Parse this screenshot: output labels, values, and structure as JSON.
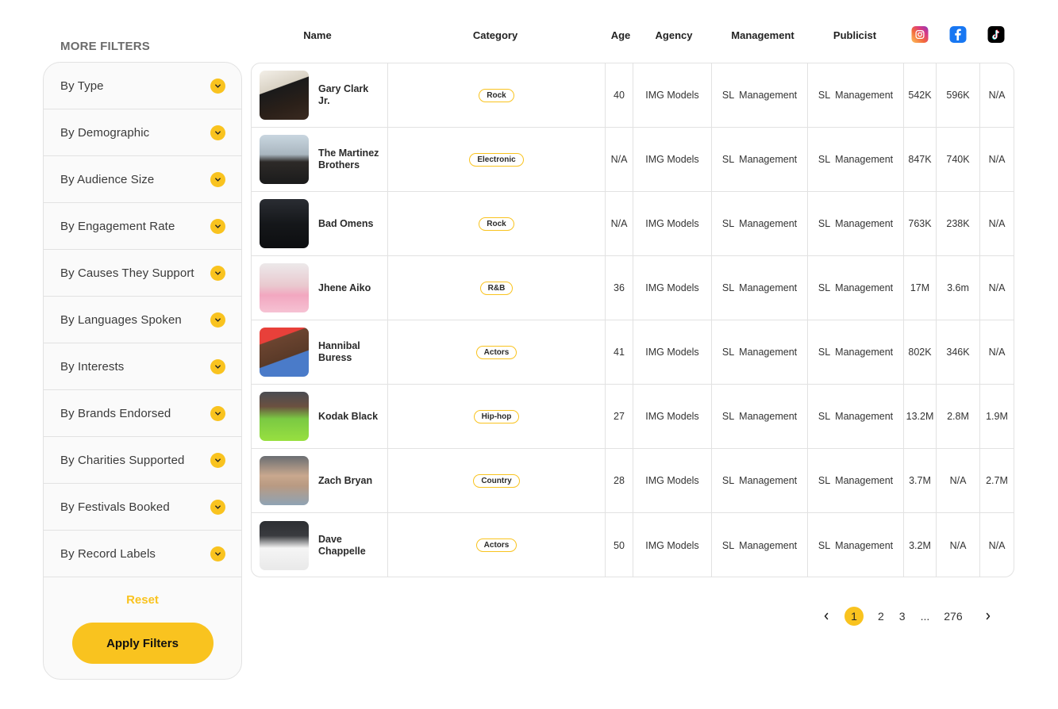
{
  "sidebar": {
    "title": "MORE FILTERS",
    "filters": [
      {
        "label": "By Type",
        "icon": "chevron-down-icon"
      },
      {
        "label": "By Demographic",
        "icon": "chevron-down-icon"
      },
      {
        "label": "By Audience Size",
        "icon": "chevron-down-icon"
      },
      {
        "label": "By Engagement Rate",
        "icon": "chevron-down-icon"
      },
      {
        "label": "By Causes They Support",
        "icon": "chevron-down-icon"
      },
      {
        "label": "By Languages Spoken",
        "icon": "chevron-down-icon"
      },
      {
        "label": "By Interests",
        "icon": "chevron-down-icon"
      },
      {
        "label": "By Brands Endorsed",
        "icon": "chevron-down-icon"
      },
      {
        "label": "By Charities Supported",
        "icon": "chevron-down-icon"
      },
      {
        "label": "By Festivals Booked",
        "icon": "chevron-down-icon"
      },
      {
        "label": "By Record Labels",
        "icon": "chevron-down-icon"
      }
    ],
    "reset_label": "Reset",
    "apply_label": "Apply Filters"
  },
  "table": {
    "headers": {
      "name": "Name",
      "category": "Category",
      "age": "Age",
      "agency": "Agency",
      "management": "Management",
      "publicist": "Publicist",
      "instagram": "instagram-icon",
      "facebook": "facebook-icon",
      "tiktok": "tiktok-icon"
    },
    "rows": [
      {
        "name": "Gary Clark Jr.",
        "category": "Rock",
        "age": "40",
        "agency": "IMG Models",
        "management": "SL  Management",
        "publicist": "SL  Management",
        "instagram": "542K",
        "facebook": "596K",
        "tiktok": "N/A"
      },
      {
        "name": "The Martinez Brothers",
        "category": "Electronic",
        "age": "N/A",
        "agency": "IMG Models",
        "management": "SL  Management",
        "publicist": "SL  Management",
        "instagram": "847K",
        "facebook": "740K",
        "tiktok": "N/A"
      },
      {
        "name": "Bad Omens",
        "category": "Rock",
        "age": "N/A",
        "agency": "IMG Models",
        "management": "SL  Management",
        "publicist": "SL  Management",
        "instagram": "763K",
        "facebook": "238K",
        "tiktok": "N/A"
      },
      {
        "name": "Jhene Aiko",
        "category": "R&B",
        "age": "36",
        "agency": "IMG Models",
        "management": "SL  Management",
        "publicist": "SL  Management",
        "instagram": "17M",
        "facebook": "3.6m",
        "tiktok": "N/A"
      },
      {
        "name": "Hannibal Buress",
        "category": "Actors",
        "age": "41",
        "agency": "IMG Models",
        "management": "SL  Management",
        "publicist": "SL  Management",
        "instagram": "802K",
        "facebook": "346K",
        "tiktok": "N/A"
      },
      {
        "name": "Kodak Black",
        "category": "Hip-hop",
        "age": "27",
        "agency": "IMG Models",
        "management": "SL  Management",
        "publicist": "SL  Management",
        "instagram": "13.2M",
        "facebook": "2.8M",
        "tiktok": "1.9M"
      },
      {
        "name": "Zach Bryan",
        "category": "Country",
        "age": "28",
        "agency": "IMG Models",
        "management": "SL  Management",
        "publicist": "SL  Management",
        "instagram": "3.7M",
        "facebook": "N/A",
        "tiktok": "2.7M"
      },
      {
        "name": "Dave Chappelle",
        "category": "Actors",
        "age": "50",
        "agency": "IMG Models",
        "management": "SL  Management",
        "publicist": "SL  Management",
        "instagram": "3.2M",
        "facebook": "N/A",
        "tiktok": "N/A"
      }
    ]
  },
  "pagination": {
    "prev_icon": "chevron-left-icon",
    "pages": [
      "1",
      "2",
      "3",
      "...",
      "276"
    ],
    "current": "1",
    "next_icon": "chevron-right-icon"
  },
  "colors": {
    "accent": "#f9c31f",
    "border": "#e2e2e2",
    "panel_bg": "#fafafa",
    "facebook": "#1877f2",
    "tiktok": "#000000"
  }
}
